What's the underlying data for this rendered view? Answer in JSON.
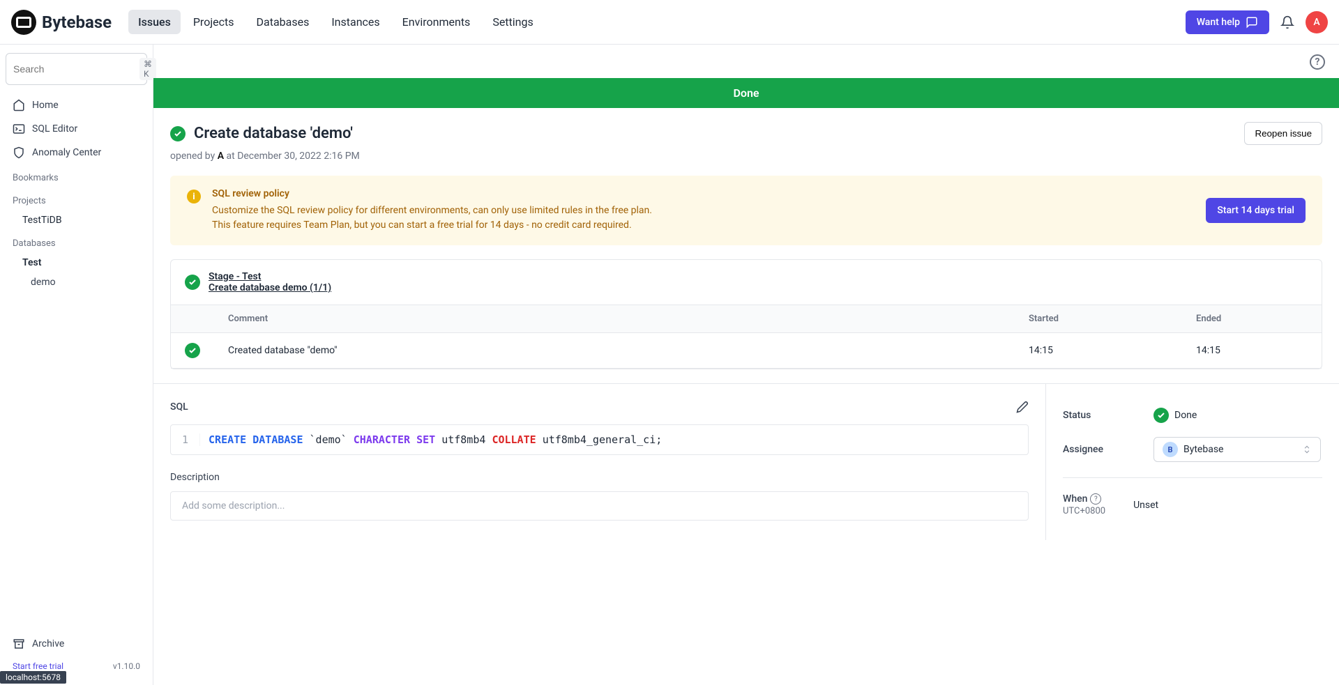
{
  "brand": "Bytebase",
  "nav": [
    "Issues",
    "Projects",
    "Databases",
    "Instances",
    "Environments",
    "Settings"
  ],
  "active_nav": 0,
  "header": {
    "help_btn": "Want help",
    "avatar_initial": "A"
  },
  "sidebar": {
    "search_placeholder": "Search",
    "search_kbd": "⌘ K",
    "items": {
      "home": "Home",
      "sql_editor": "SQL Editor",
      "anomaly_center": "Anomaly Center",
      "archive": "Archive"
    },
    "bookmarks_label": "Bookmarks",
    "projects_label": "Projects",
    "projects": [
      "TestTiDB"
    ],
    "databases_label": "Databases",
    "databases": [
      {
        "name": "Test",
        "children": [
          "demo"
        ]
      }
    ],
    "start_trial": "Start free trial",
    "version": "v1.10.0"
  },
  "banner": "Done",
  "issue": {
    "title": "Create database 'demo'",
    "reopen_btn": "Reopen issue",
    "opened_prefix": "opened by",
    "opened_user": "A",
    "opened_at": "at December 30, 2022 2:16 PM"
  },
  "promo": {
    "title": "SQL review policy",
    "line1": "Customize the SQL review policy for different environments, can only use limited rules in the free plan.",
    "line2": "This feature requires Team Plan, but you can start a free trial for 14 days - no credit card required.",
    "btn": "Start 14 days trial"
  },
  "stage": {
    "title": "Stage - Test",
    "subtitle": "Create database demo (1/1)"
  },
  "table": {
    "headers": [
      "",
      "Comment",
      "Started",
      "Ended"
    ],
    "rows": [
      {
        "comment": "Created database \"demo\"",
        "started": "14:15",
        "ended": "14:15"
      }
    ]
  },
  "sql": {
    "label": "SQL",
    "line_number": "1",
    "tokens": {
      "create": "CREATE",
      "database": "DATABASE",
      "name": "`demo`",
      "character": "CHARACTER",
      "set": "SET",
      "charset": "utf8mb4",
      "collate": "COLLATE",
      "collation": "utf8mb4_general_ci;"
    }
  },
  "description": {
    "label": "Description",
    "placeholder": "Add some description..."
  },
  "meta": {
    "status_label": "Status",
    "status_value": "Done",
    "assignee_label": "Assignee",
    "assignee_value": "Bytebase",
    "assignee_initial": "B",
    "when_label": "When",
    "when_tz": "UTC+0800",
    "when_value": "Unset"
  },
  "localhost": "localhost:5678"
}
